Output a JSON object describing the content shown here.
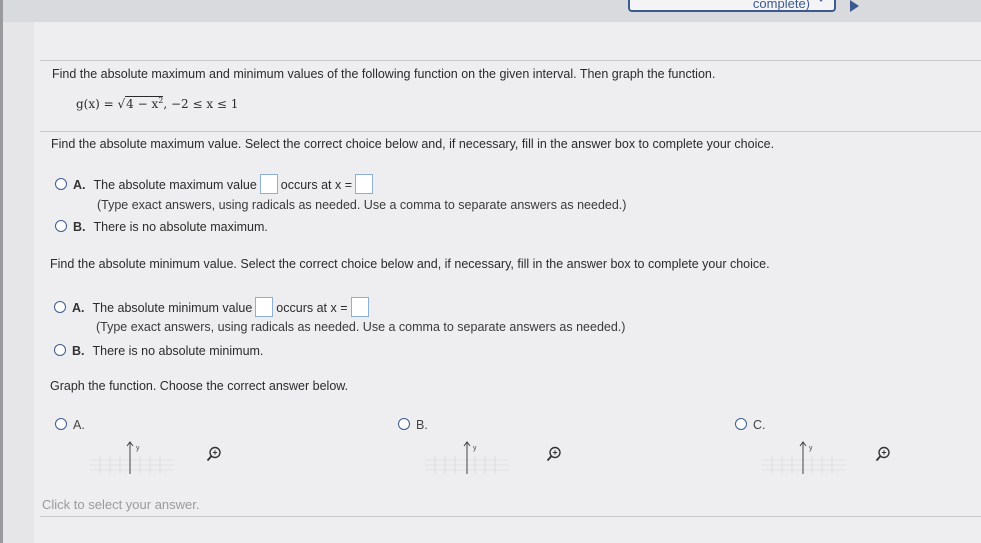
{
  "progress": {
    "label": "complete)"
  },
  "question": {
    "prompt": "Find the absolute maximum and minimum values of the following function on the given interval. Then graph the function.",
    "func_lhs": "g(x) = ",
    "func_radicand": "4 − x",
    "func_exp": "2",
    "func_interval": ", −2 ≤ x ≤ 1"
  },
  "max_section": {
    "instruction": "Find the absolute maximum value. Select the correct choice below and, if necessary, fill in the answer box to complete your choice.",
    "option_a": {
      "letter": "A.",
      "text1": "The absolute maximum value",
      "text2": "occurs at x =",
      "hint": "(Type exact answers, using radicals as needed. Use a comma to separate answers as needed.)"
    },
    "option_b": {
      "letter": "B.",
      "text": "There is no absolute maximum."
    }
  },
  "min_section": {
    "instruction": "Find the absolute minimum value. Select the correct choice below and, if necessary, fill in the answer box to complete your choice.",
    "option_a": {
      "letter": "A.",
      "text1": "The absolute minimum value",
      "text2": "occurs at x =",
      "hint": "(Type exact answers, using radicals as needed. Use a comma to separate answers as needed.)"
    },
    "option_b": {
      "letter": "B.",
      "text": "There is no absolute minimum."
    }
  },
  "graph_section": {
    "instruction": "Graph the function. Choose the correct answer below.",
    "options": [
      {
        "label": "A."
      },
      {
        "label": "B."
      },
      {
        "label": "C."
      }
    ],
    "axis_label": "y",
    "click_hint": "Click to select your answer."
  },
  "colors": {
    "accent": "#3c5a90",
    "answer_box_border": "#8fb0d6"
  }
}
